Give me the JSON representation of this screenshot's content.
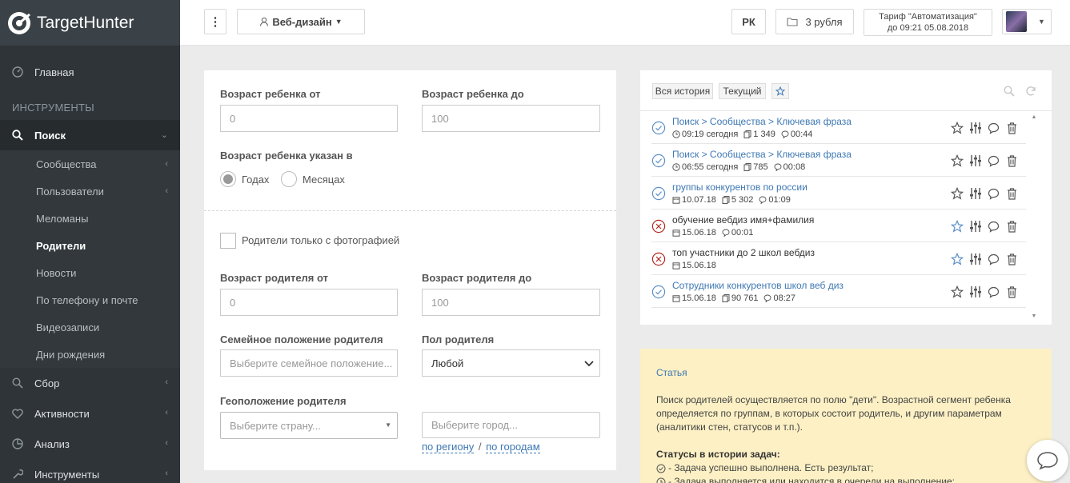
{
  "brand": {
    "name_a": "Target",
    "name_b": "Hunter"
  },
  "sidebar": {
    "home": "Главная",
    "section": "ИНСТРУМЕНТЫ",
    "search": "Поиск",
    "sub": [
      "Сообщества",
      "Пользователи",
      "Меломаны",
      "Родители",
      "Новости",
      "По телефону и почте",
      "Видеозаписи",
      "Дни рождения"
    ],
    "collect": "Сбор",
    "activity": "Активности",
    "analysis": "Анализ",
    "tools": "Инструменты"
  },
  "topbar": {
    "project": "Веб-дизайн",
    "account": "РК",
    "balance": "3 рубля",
    "tariff_line1": "Тариф \"Автоматизация\"",
    "tariff_line2": "до 09:21 05.08.2018"
  },
  "form": {
    "child_age_from_label": "Возраст ребенка от",
    "child_age_from_placeholder": "0",
    "child_age_to_label": "Возраст ребенка до",
    "child_age_to_placeholder": "100",
    "unit_label": "Возраст ребенка указан в",
    "unit_years": "Годах",
    "unit_months": "Месяцах",
    "photo_only": "Родители только с фотографией",
    "parent_age_from_label": "Возраст родителя от",
    "parent_age_from_placeholder": "0",
    "parent_age_to_label": "Возраст родителя до",
    "parent_age_to_placeholder": "100",
    "family_label": "Семейное положение родителя",
    "family_placeholder": "Выберите семейное положение...",
    "sex_label": "Пол родителя",
    "sex_value": "Любой",
    "geo_label": "Геоположение родителя",
    "country_placeholder": "Выберите страну...",
    "city_placeholder": "Выберите город...",
    "by_region": "по региону",
    "sep": "/",
    "by_cities": "по городам"
  },
  "history": {
    "all": "Вся история",
    "current": "Текущий",
    "rows": [
      {
        "title": "Поиск > Сообщества > Ключевая фраза",
        "time": "09:19 сегодня",
        "count": "1 349",
        "duration": "00:44",
        "status": "ok",
        "link": true
      },
      {
        "title": "Поиск > Сообщества > Ключевая фраза",
        "time": "06:55 сегодня",
        "count": "785",
        "duration": "00:08",
        "status": "ok",
        "link": true
      },
      {
        "title": "группы конкурентов по россии",
        "time": "10.07.18",
        "count": "5 302",
        "duration": "01:09",
        "status": "ok",
        "link": true
      },
      {
        "title": "обучение вебдиз имя+фамилия",
        "time": "15.06.18",
        "count": "",
        "duration": "00:01",
        "status": "error",
        "link": false
      },
      {
        "title": "топ участники до 2 школ вебдиз",
        "time": "15.06.18",
        "count": "",
        "duration": "",
        "status": "error",
        "link": false
      },
      {
        "title": "Сотрудники конкурентов школ веб диз",
        "time": "15.06.18",
        "count": "90 761",
        "duration": "08:27",
        "status": "ok",
        "link": true
      }
    ]
  },
  "info": {
    "article": "Статья",
    "text": "Поиск родителей осуществляется по полю \"дети\". Возрастной сегмент ребенка определяется по группам, в которых состоит родитель, и другим параметрам (аналитики стен, статусов и т.п.).",
    "statuses_title": "Статусы в истории задач:",
    "status_ok": "- Задача успешно выполнена. Есть результат;",
    "status_queue": "- Задача выполняется или находится в очереди на выполнение;"
  },
  "colors": {
    "sidebar": "#2e3438",
    "accent": "#3e78b3",
    "info_bg": "#fcf0c4",
    "ok": "#5b8fc7",
    "error": "#b3261e"
  }
}
